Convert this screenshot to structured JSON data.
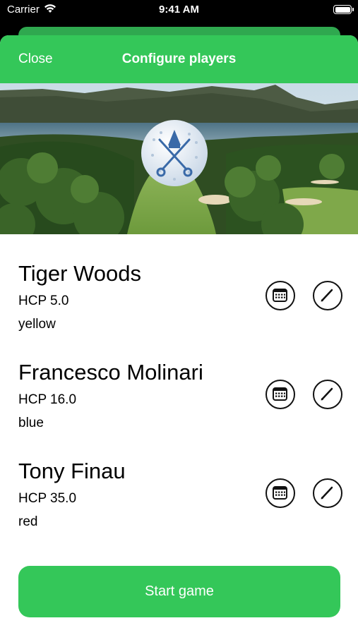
{
  "status_bar": {
    "carrier": "Carrier",
    "time": "9:41 AM",
    "battery_level": 1.0
  },
  "nav": {
    "close_label": "Close",
    "title": "Configure players"
  },
  "hero": {
    "logo_icon": "crossed-keys-golf-ball-crest-icon",
    "image": "golf-course-lake-landscape"
  },
  "players": [
    {
      "name": "Tiger Woods",
      "hcp": "HCP 5.0",
      "tee": "yellow"
    },
    {
      "name": "Francesco Molinari",
      "hcp": "HCP 16.0",
      "tee": "blue"
    },
    {
      "name": "Tony Finau",
      "hcp": "HCP 35.0",
      "tee": "red"
    }
  ],
  "actions": {
    "start_label": "Start game"
  },
  "icons": {
    "calendar": "calendar-icon",
    "edit": "pencil-icon"
  },
  "colors": {
    "accent": "#34c759",
    "back_card": "#2fa84f"
  }
}
